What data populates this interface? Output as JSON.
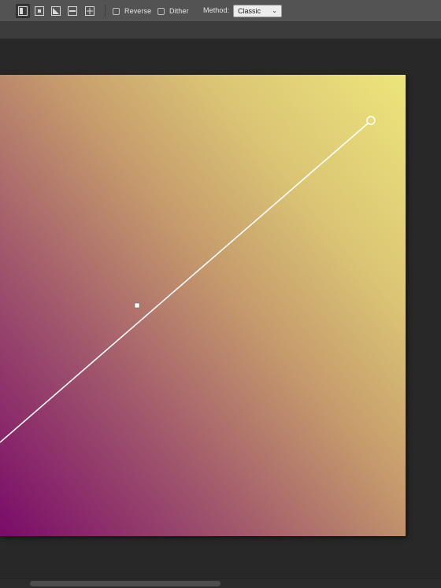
{
  "options_bar": {
    "gradient_types": [
      {
        "name": "linear-gradient-icon",
        "active": true
      },
      {
        "name": "radial-gradient-icon",
        "active": false
      },
      {
        "name": "angle-gradient-icon",
        "active": false
      },
      {
        "name": "reflected-gradient-icon",
        "active": false
      },
      {
        "name": "diamond-gradient-icon",
        "active": false
      }
    ],
    "reverse_label": "Reverse",
    "reverse_checked": false,
    "dither_label": "Dither",
    "dither_checked": false,
    "method_label": "Method:",
    "method_value": "Classic"
  },
  "colors": {
    "gradient_start": "#7a0b6a",
    "gradient_end": "#ece57b",
    "toolbar_bg": "#535353",
    "workspace_bg": "#282828"
  }
}
